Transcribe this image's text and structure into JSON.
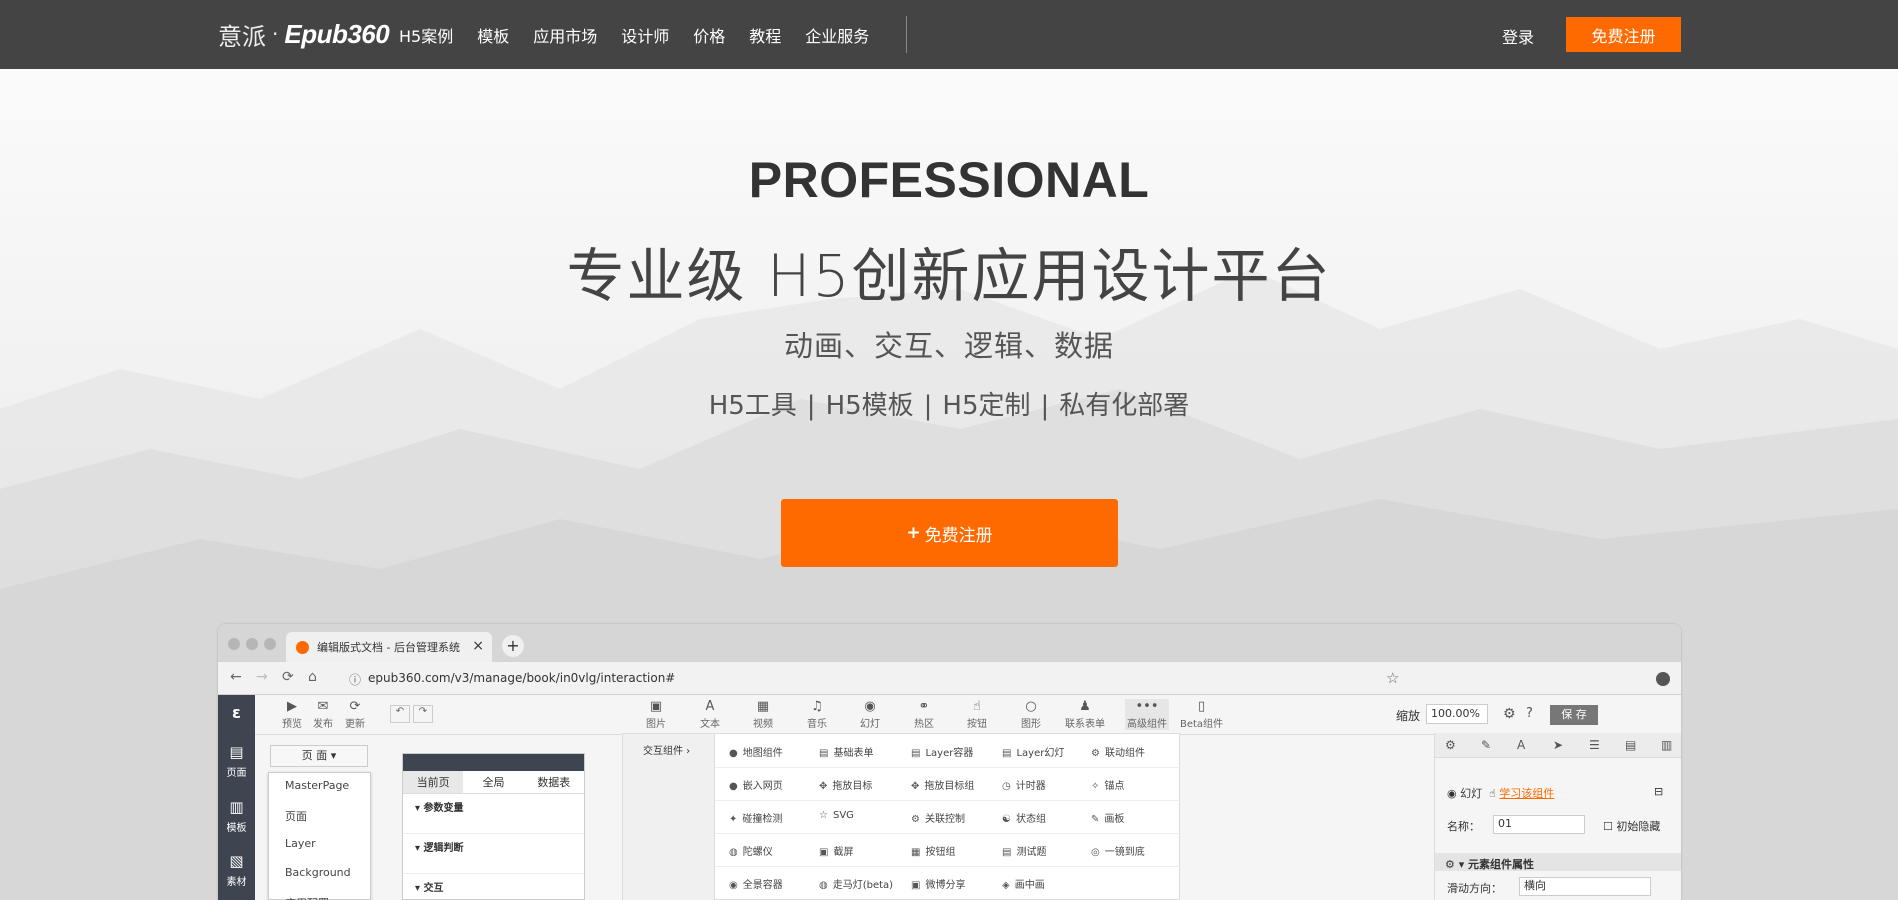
{
  "nav": {
    "logo_cn": "意派",
    "logo_dot": "·",
    "logo_brand": "Epub360",
    "links": [
      "H5案例",
      "模板",
      "应用市场",
      "设计师",
      "价格",
      "教程",
      "企业服务"
    ],
    "login": "登录",
    "register": "免费注册"
  },
  "hero": {
    "title": "PROFESSIONAL",
    "subtitle": "专业级  H5创新应用设计平台",
    "line3": "动画、交互、逻辑、数据",
    "line4": [
      "H5工具",
      "H5模板",
      "H5定制",
      "私有化部署"
    ],
    "line4_sep": "|",
    "cta_icon": "+",
    "cta_label": "免费注册"
  },
  "browser": {
    "tab_title": "编辑版式文档 - 后台管理系统",
    "tab_close": "×",
    "new_tab": "+",
    "url": "epub360.com/v3/manage/book/in0vlg/interaction#",
    "side": [
      {
        "icon": "page-icon",
        "glyph": "▤",
        "label": "页面"
      },
      {
        "icon": "template-icon",
        "glyph": "▥",
        "label": "模板"
      },
      {
        "icon": "material-icon",
        "glyph": "▧",
        "label": "素材"
      }
    ],
    "side_logo": "ε",
    "toolbar_left": [
      {
        "icon": "preview-icon",
        "glyph": "▶",
        "label": "预览"
      },
      {
        "icon": "publish-icon",
        "glyph": "✉",
        "label": "发布"
      },
      {
        "icon": "update-icon",
        "glyph": "⟳",
        "label": "更新"
      }
    ],
    "undo": "↶",
    "redo": "↷",
    "toolbar_center": [
      {
        "icon": "image-icon",
        "glyph": "▣",
        "label": "图片"
      },
      {
        "icon": "text-icon",
        "glyph": "A",
        "label": "文本"
      },
      {
        "icon": "video-icon",
        "glyph": "▦",
        "label": "视频"
      },
      {
        "icon": "music-icon",
        "glyph": "♫",
        "label": "音乐"
      },
      {
        "icon": "slide-icon",
        "glyph": "◉",
        "label": "幻灯"
      },
      {
        "icon": "hotspot-icon",
        "glyph": "⚭",
        "label": "热区"
      },
      {
        "icon": "button-icon",
        "glyph": "☝",
        "label": "按钮"
      },
      {
        "icon": "shape-icon",
        "glyph": "○",
        "label": "图形"
      },
      {
        "icon": "contact-form-icon",
        "glyph": "♟",
        "label": "联系表单"
      },
      {
        "icon": "advanced-icon",
        "glyph": "•••",
        "label": "高级组件"
      },
      {
        "icon": "beta-icon",
        "glyph": "▯",
        "label": "Beta组件"
      }
    ],
    "zoom_label": "缩放",
    "zoom_value": "100.00%",
    "settings_glyph": "⚙",
    "help_glyph": "?",
    "save": "保 存",
    "page_select": "页 面",
    "page_menu": [
      "MasterPage",
      "页面",
      "Layer",
      "Background",
      "应用配置"
    ],
    "panel_tabs": [
      "当前页",
      "全局",
      "数据表"
    ],
    "panel_sections": [
      "参数变量",
      "逻辑判断",
      "交互"
    ],
    "comp_category": "交互组件 ›",
    "components": [
      [
        "地图组件",
        "基础表单",
        "Layer容器",
        "Layer幻灯",
        "联动组件"
      ],
      [
        "嵌入网页",
        "拖放目标",
        "拖放目标组",
        "计时器",
        "锚点"
      ],
      [
        "碰撞检测",
        "SVG",
        "关联控制",
        "状态组",
        "画板"
      ],
      [
        "陀螺仪",
        "截屏",
        "按钮组",
        "测试题",
        "一镜到底"
      ],
      [
        "全景容器",
        "走马灯(beta)",
        "微博分享",
        "画中画",
        ""
      ]
    ],
    "component_glyphs": [
      [
        "●",
        "▤",
        "▤",
        "▤",
        "⚙"
      ],
      [
        "●",
        "✥",
        "✥",
        "◷",
        "✧"
      ],
      [
        "✦",
        "☆",
        "⚙",
        "☯",
        "✎"
      ],
      [
        "◍",
        "▣",
        "▦",
        "▤",
        "◎"
      ],
      [
        "◉",
        "◍",
        "▣",
        "◈",
        ""
      ]
    ],
    "right_tabs": [
      "⚙",
      "✎",
      "A",
      "➤",
      "☰",
      "▤",
      "▥"
    ],
    "rp_slide": "幻灯",
    "rp_learn": "学习该组件",
    "rp_name_label": "名称：",
    "rp_name_value": "01",
    "rp_hidden": "初始隐藏",
    "rp_section": "元素组件属性",
    "rp_dir_label": "滑动方向：",
    "rp_dir_value": "横向"
  }
}
